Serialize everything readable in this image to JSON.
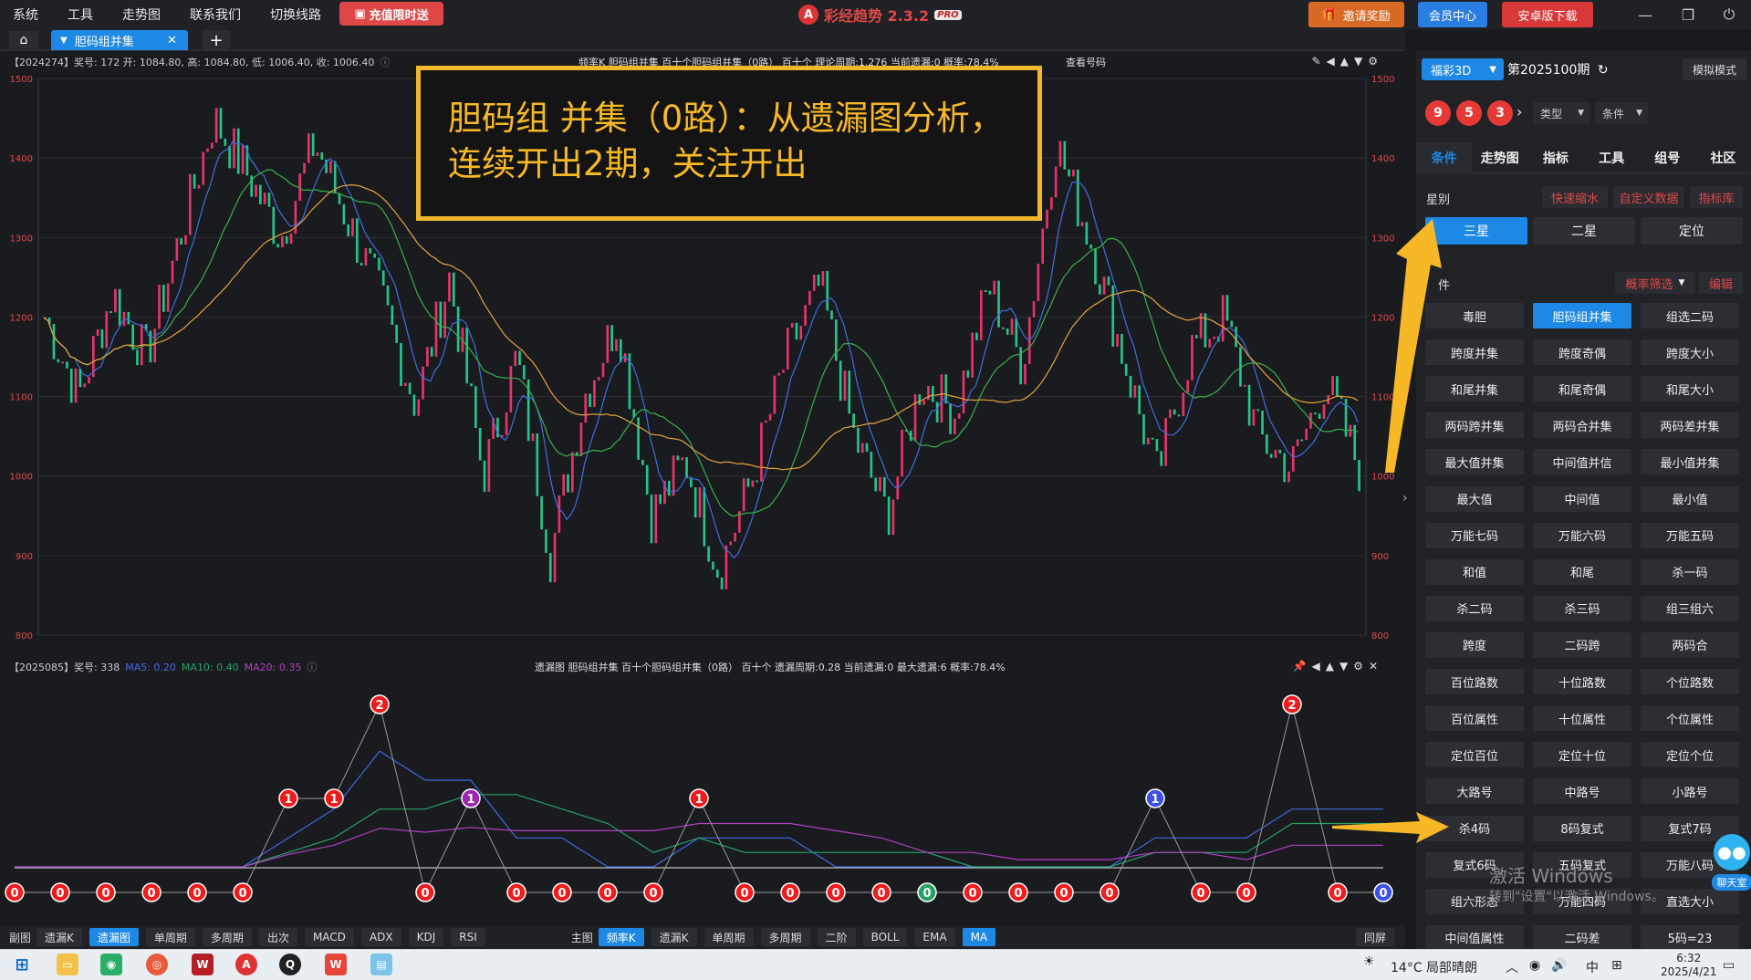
{
  "menu": [
    "系统",
    "工具",
    "走势图",
    "联系我们",
    "切换线路"
  ],
  "recharge_label": "充值限时送",
  "brand": {
    "name": "彩经趋势 2.3.2",
    "badge": "PRO",
    "logo_text": "A"
  },
  "top_buttons": {
    "invite": "邀请奖励",
    "member": "会员中心",
    "android": "安卓版下载"
  },
  "window_controls": {
    "minimize": "—",
    "restore": "❐",
    "close": "⏻"
  },
  "tab": {
    "label": "胆码组并集",
    "close": "✕",
    "add": "+",
    "home": "⌂"
  },
  "kline": {
    "header_left": "【2024274】奖号: 172  开: 1084.80, 高: 1084.80, 低: 1006.40, 收: 1006.40",
    "header_mid": "频率K   胆码组并集   百十个胆码组并集（0路）   百十个   理论周期:1.276   当前遗漏:0   概率:78.4%",
    "header_right": "查看号码",
    "y_ticks": [
      "1500",
      "1400",
      "1300",
      "1200",
      "1100",
      "1000",
      "900",
      "800"
    ]
  },
  "miss": {
    "header_left_prefix": "【2025085】奖号: 338",
    "ma5": "MA5: 0.20",
    "ma10": "MA10: 0.40",
    "ma20": "MA20: 0.35",
    "header_mid": "遗漏图   胆码组并集   百十个胆码组并集（0路）   百十个   遗漏周期:0.28   当前遗漏:0   最大遗漏:6   概率:78.4%",
    "values": [
      0,
      0,
      0,
      0,
      0,
      0,
      1,
      1,
      2,
      0,
      1,
      0,
      0,
      0,
      0,
      1,
      0,
      0,
      0,
      0,
      0,
      0,
      0,
      0,
      0,
      1,
      0,
      0,
      2,
      0,
      0
    ],
    "colors": {
      "red": "#ee1c1c",
      "purple": "#9c27b0",
      "blue": "#3f51e5",
      "green": "#26a269"
    }
  },
  "annotation": {
    "line1": "胆码组 并集（0路）：从遗漏图分析，",
    "line2": "连续开出2期，关注开出"
  },
  "toolbar_left": {
    "label": "副图",
    "buttons": [
      "遗漏K",
      "遗漏图",
      "单周期",
      "多周期",
      "出次",
      "MACD",
      "ADX",
      "KDJ",
      "RSI"
    ],
    "active": 1
  },
  "toolbar_mid": {
    "label": "主图",
    "buttons": [
      "频率K",
      "遗漏K",
      "单周期",
      "多周期",
      "二阶",
      "BOLL",
      "EMA",
      "MA"
    ],
    "active": [
      0,
      7
    ]
  },
  "toolbar_right": "同屏",
  "panel": {
    "lottery": "福彩3D",
    "issue": "第2025100期",
    "refresh": "↻",
    "simulate": "模拟模式",
    "balls": [
      "9",
      "5",
      "3"
    ],
    "type_dd": "类型",
    "cond_dd": "条件",
    "tabs": [
      "条件",
      "走势图",
      "指标",
      "工具",
      "组号",
      "社区"
    ],
    "star_label": "星别",
    "red_buttons": [
      "快速缩水",
      "自定义数据",
      "指标库"
    ],
    "stars": [
      "三星",
      "二星",
      "定位"
    ],
    "filter_label": "件",
    "prob_filter": "概率筛选",
    "edit": "编辑",
    "conditions": [
      "毒胆",
      "胆码组并集",
      "组选二码",
      "跨度并集",
      "跨度奇偶",
      "跨度大小",
      "和尾并集",
      "和尾奇偶",
      "和尾大小",
      "两码跨并集",
      "两码合并集",
      "两码差并集",
      "最大值并集",
      "中间值并信",
      "最小值并集",
      "最大值",
      "中间值",
      "最小值",
      "万能七码",
      "万能六码",
      "万能五码",
      "和值",
      "和尾",
      "杀一码",
      "杀二码",
      "杀三码",
      "组三组六",
      "跨度",
      "二码跨",
      "两码合",
      "百位路数",
      "十位路数",
      "个位路数",
      "百位属性",
      "十位属性",
      "个位属性",
      "定位百位",
      "定位十位",
      "定位个位",
      "大路号",
      "中路号",
      "小路号",
      "杀4码",
      "8码复式",
      "复式7码",
      "复式6码",
      "五码复式",
      "万能八码",
      "组六形态",
      "万能四码",
      "直选大小",
      "中间值属性",
      "二码差",
      "5码=23"
    ],
    "active_condition": 1
  },
  "watermark": {
    "line1": "激活 Windows",
    "line2": "转到\"设置\"以激活 Windows。"
  },
  "chat_label": "聊天室",
  "taskbar": {
    "weather": "14°C 局部晴朗",
    "ime": "中",
    "time": "6:32",
    "date": "2025/4/21"
  }
}
